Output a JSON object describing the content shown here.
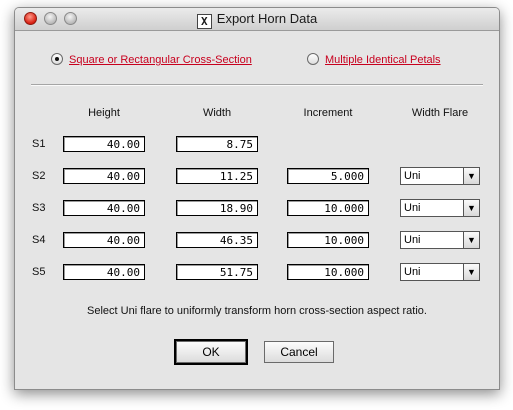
{
  "window": {
    "title": "Export Horn Data",
    "icon_glyph": "X"
  },
  "cross_section": {
    "options": [
      {
        "label": "Square or Rectangular Cross-Section",
        "selected": true
      },
      {
        "label": "Multiple Identical Petals",
        "selected": false
      }
    ]
  },
  "table": {
    "headers": {
      "height": "Height",
      "width": "Width",
      "increment": "Increment",
      "width_flare": "Width Flare"
    },
    "rows": [
      {
        "label": "S1",
        "height": "40.00",
        "width": "8.75",
        "increment": null,
        "flare": null
      },
      {
        "label": "S2",
        "height": "40.00",
        "width": "11.25",
        "increment": "5.000",
        "flare": "Uni"
      },
      {
        "label": "S3",
        "height": "40.00",
        "width": "18.90",
        "increment": "10.000",
        "flare": "Uni"
      },
      {
        "label": "S4",
        "height": "40.00",
        "width": "46.35",
        "increment": "10.000",
        "flare": "Uni"
      },
      {
        "label": "S5",
        "height": "40.00",
        "width": "51.75",
        "increment": "10.000",
        "flare": "Uni"
      }
    ]
  },
  "hint": "Select Uni flare to uniformly transform horn cross-section aspect ratio.",
  "buttons": {
    "ok": "OK",
    "cancel": "Cancel"
  },
  "colors": {
    "accent_label": "#c8001e",
    "dialog_bg": "#e5e5e5",
    "close_button": "#d81e10"
  },
  "icons": {
    "select_arrow": "▼"
  }
}
